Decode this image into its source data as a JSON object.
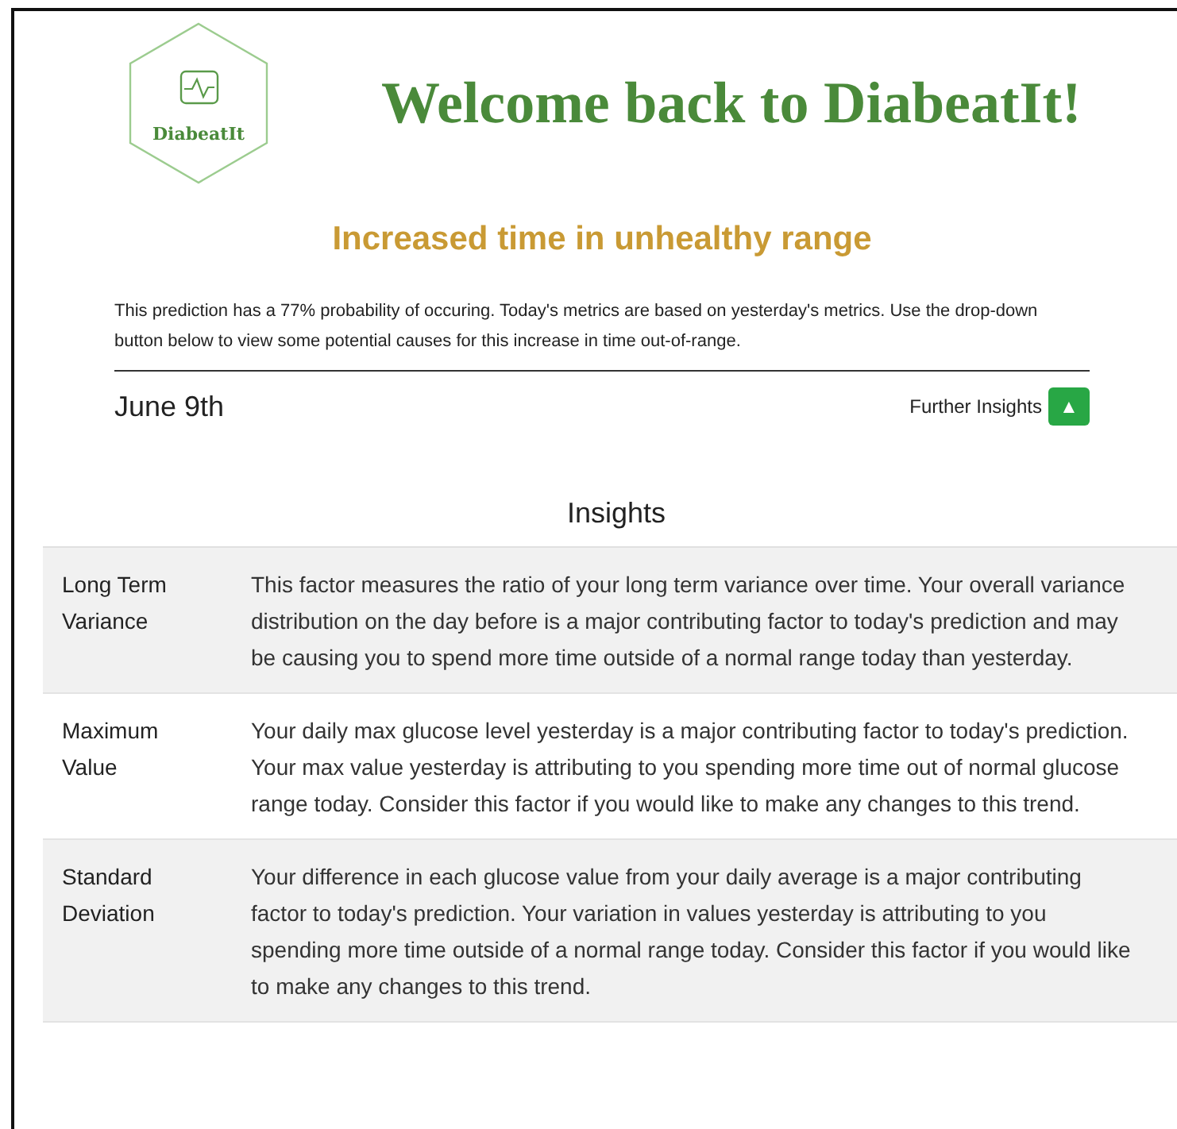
{
  "header": {
    "logo_text": "DiabeatIt",
    "title": "Welcome back to DiabeatIt!"
  },
  "prediction": {
    "heading": "Increased time in unhealthy range",
    "description": "This prediction has a 77% probability of occuring. Today's metrics are based on yesterday's metrics. Use the drop-down button below to view some potential causes for this increase in time out-of-range.",
    "date": "June 9th",
    "further_label": "Further Insights",
    "toggle_glyph": "▲"
  },
  "insights": {
    "title": "Insights",
    "rows": [
      {
        "factor": "Long Term Variance",
        "text": "This factor measures the ratio of your long term variance over time. Your overall variance distribution on the day before is a major contributing factor to today's prediction and may be causing you to spend more time outside of a normal range today than yesterday."
      },
      {
        "factor": "Maximum Value",
        "text": "Your daily max glucose level yesterday is a major contributing factor to today's prediction. Your max value yesterday is attributing to you spending more time out of normal glucose range today. Consider this factor if you would like to make any changes to this trend."
      },
      {
        "factor": "Standard Deviation",
        "text": "Your difference in each glucose value from your daily average is a major contributing factor to today's prediction. Your variation in values yesterday is attributing to you spending more time outside of a normal range today. Consider this factor if you would like to make any changes to this trend."
      }
    ]
  }
}
